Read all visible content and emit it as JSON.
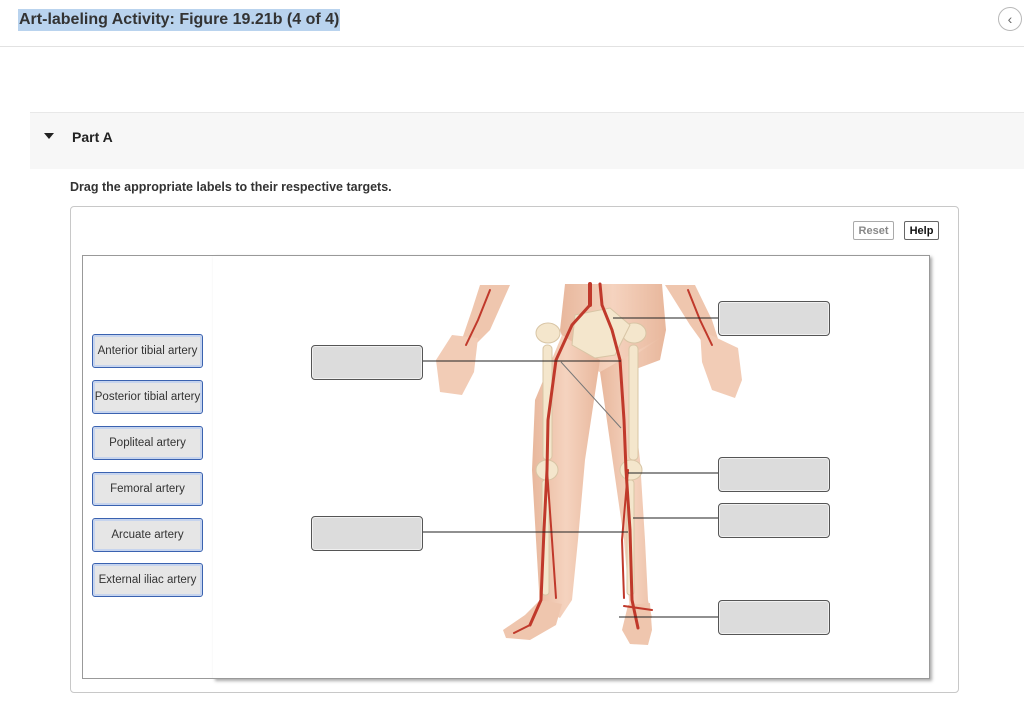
{
  "header": {
    "title": "Art-labeling Activity: Figure 19.21b (4 of 4)",
    "back_icon": "chevron-left-icon"
  },
  "part": {
    "label": "Part A",
    "toggle_icon": "caret-down-icon"
  },
  "instruction": "Drag the appropriate labels to their respective targets.",
  "toolbar": {
    "reset_label": "Reset",
    "help_label": "Help"
  },
  "labels": [
    "Anterior tibial artery",
    "Posterior tibial artery",
    "Popliteal artery",
    "Femoral artery",
    "Arcuate artery",
    "External iliac artery"
  ],
  "targets_count": 6,
  "colors": {
    "accent": "#3a62b0",
    "title_highlight": "#b9d3ee",
    "artery": "#c0392b",
    "skin": "#f0c4a8"
  }
}
